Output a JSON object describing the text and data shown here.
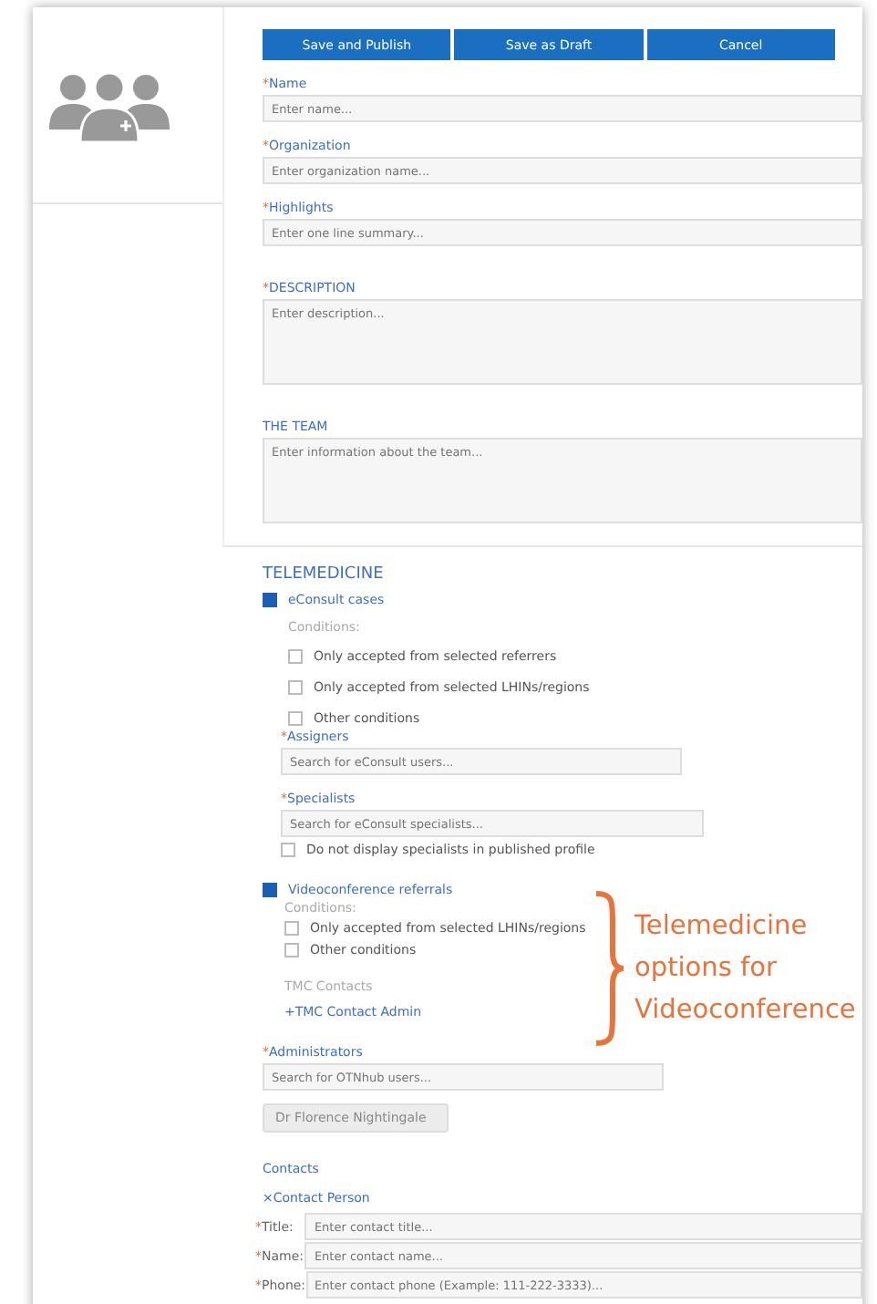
{
  "buttons": [
    "Save and Publish",
    "Save as Draft",
    "Cancel"
  ],
  "fields": [
    {
      "mark": "*",
      "label": "Name",
      "placeholder": "Enter name...",
      "kind": "input"
    },
    {
      "mark": "*",
      "label": "Organization",
      "placeholder": "Enter organization name...",
      "kind": "input"
    },
    {
      "mark": "*",
      "label": "Highlights",
      "placeholder": "Enter one line summary...",
      "kind": "input"
    },
    {
      "mark": "*",
      "label": "DESCRIPTION",
      "placeholder": "Enter description...",
      "kind": "textarea"
    },
    {
      "label": "THE TEAM",
      "placeholder": "Enter information about the team...",
      "kind": "textarea"
    }
  ],
  "telemedicine": {
    "title": "TELEMEDICINE",
    "econsult": {
      "label": "eConsult cases",
      "checked": true,
      "conditions_label": "Conditions:",
      "conditions": [
        {
          "label": "Only accepted from selected referrers",
          "checked": false
        },
        {
          "label": "Only accepted from selected LHINs/regions",
          "checked": false
        },
        {
          "label": "Other conditions",
          "checked": false
        }
      ],
      "assigners": {
        "mark": "*",
        "label": "Assigners",
        "placeholder": "Search for eConsult users..."
      },
      "specialists": {
        "mark": "*",
        "label": "Specialists",
        "placeholder": "Search for eConsult specialists..."
      },
      "hide_specialists": {
        "label": "Do not display specialists in published profile",
        "checked": false
      }
    },
    "videoconference": {
      "label": "Videoconference referrals",
      "checked": true,
      "conditions_label": "Conditions:",
      "conditions": [
        {
          "label": "Only accepted from selected LHINs/regions",
          "checked": false
        },
        {
          "label": "Other conditions",
          "checked": false
        }
      ],
      "contacts_label": "TMC Contacts",
      "add_link": "+TMC Contact Admin"
    }
  },
  "administrators": {
    "mark": "*",
    "label": "Administrators",
    "placeholder": "Search for OTNhub users...",
    "chips": [
      "Dr Florence Nightingale"
    ]
  },
  "contacts": {
    "title": "Contacts",
    "remove_link": "×Contact Person",
    "fields": [
      {
        "mark": "*",
        "label": "Title:",
        "placeholder": "Enter contact title..."
      },
      {
        "mark": "*",
        "label": "Name:",
        "placeholder": "Enter contact name..."
      },
      {
        "mark": "*",
        "label": "Phone:",
        "placeholder": "Enter contact phone (Example: 111-222-3333)..."
      }
    ]
  },
  "annotation": {
    "text": "Telemedicine options for Videoconference"
  }
}
